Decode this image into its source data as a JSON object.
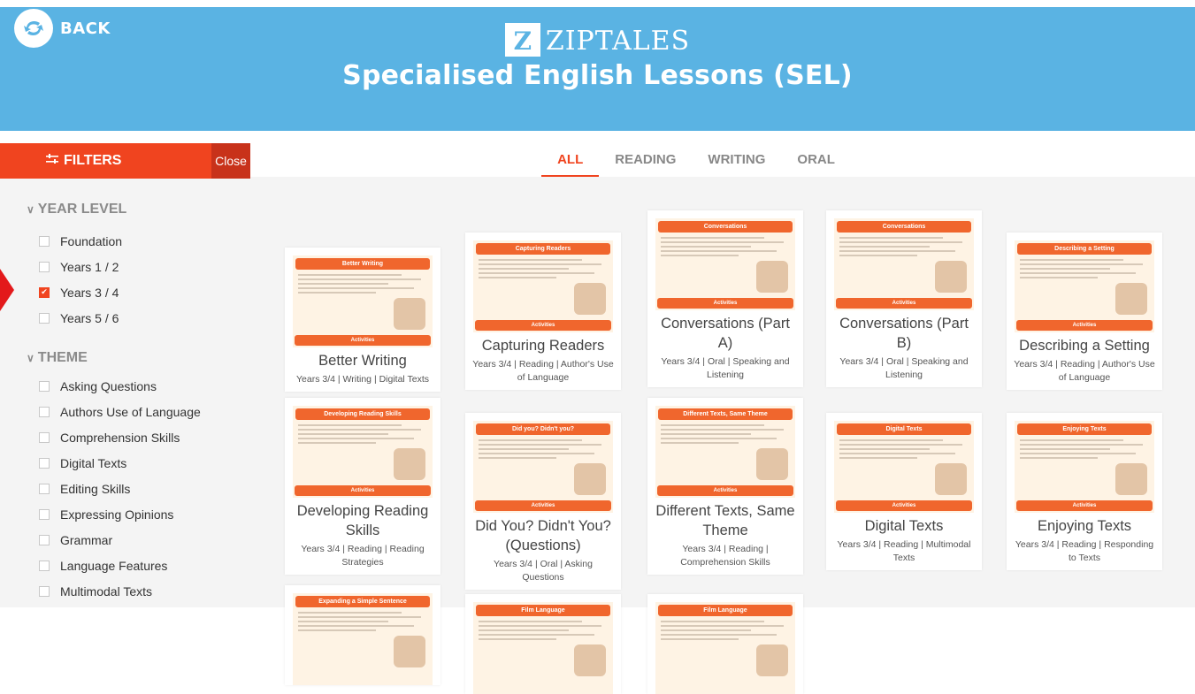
{
  "header": {
    "back_label": "BACK",
    "brand_name": "ZIPTALES",
    "brand_letter": "Z",
    "subtitle": "Specialised English Lessons (SEL)"
  },
  "filters": {
    "title": "FILTERS",
    "close_label": "Close",
    "year_level": {
      "heading": "YEAR LEVEL",
      "options": [
        {
          "label": "Foundation",
          "checked": false
        },
        {
          "label": "Years 1 / 2",
          "checked": false
        },
        {
          "label": "Years 3 / 4",
          "checked": true
        },
        {
          "label": "Years 5 / 6",
          "checked": false
        }
      ]
    },
    "theme": {
      "heading": "THEME",
      "options": [
        {
          "label": "Asking Questions",
          "checked": false
        },
        {
          "label": "Authors Use of Language",
          "checked": false
        },
        {
          "label": "Comprehension Skills",
          "checked": false
        },
        {
          "label": "Digital Texts",
          "checked": false
        },
        {
          "label": "Editing Skills",
          "checked": false
        },
        {
          "label": "Expressing Opinions",
          "checked": false
        },
        {
          "label": "Grammar",
          "checked": false
        },
        {
          "label": "Language Features",
          "checked": false
        },
        {
          "label": "Multimodal Texts",
          "checked": false
        }
      ]
    }
  },
  "tabs": [
    {
      "label": "ALL",
      "active": true
    },
    {
      "label": "READING",
      "active": false
    },
    {
      "label": "WRITING",
      "active": false
    },
    {
      "label": "ORAL",
      "active": false
    }
  ],
  "cards": [
    {
      "thumb_title": "Better Writing",
      "title": "Better Writing",
      "meta": "Years 3/4 | Writing | Digital Texts",
      "button": "Activities"
    },
    {
      "thumb_title": "Capturing Readers",
      "title": "Capturing Readers",
      "meta": "Years 3/4 | Reading | Author's Use of Language",
      "button": "Activities"
    },
    {
      "thumb_title": "Conversations",
      "title": "Conversations (Part A)",
      "meta": "Years 3/4 | Oral | Speaking and Listening",
      "button": "Activities"
    },
    {
      "thumb_title": "Conversations",
      "title": "Conversations (Part B)",
      "meta": "Years 3/4 | Oral | Speaking and Listening",
      "button": "Activities"
    },
    {
      "thumb_title": "Describing a Setting",
      "title": "Describing a Setting",
      "meta": "Years 3/4 | Reading | Author's Use of Language",
      "button": "Activities"
    },
    {
      "thumb_title": "Developing Reading Skills",
      "title": "Developing Reading Skills",
      "meta": "Years 3/4 | Reading | Reading Strategies",
      "button": "Activities"
    },
    {
      "thumb_title": "Did you? Didn't you?",
      "title": "Did You? Didn't You? (Questions)",
      "meta": "Years 3/4 | Oral | Asking Questions",
      "button": "Activities"
    },
    {
      "thumb_title": "Different Texts, Same Theme",
      "title": "Different Texts, Same Theme",
      "meta": "Years 3/4 | Reading | Comprehension Skills",
      "button": "Activities"
    },
    {
      "thumb_title": "Digital Texts",
      "title": "Digital Texts",
      "meta": "Years 3/4 | Reading | Multimodal Texts",
      "button": "Activities"
    },
    {
      "thumb_title": "Enjoying Texts",
      "title": "Enjoying Texts",
      "meta": "Years 3/4 | Reading | Responding to Texts",
      "button": "Activities"
    },
    {
      "thumb_title": "Expanding a Simple Sentence",
      "title": "",
      "meta": "",
      "button": ""
    },
    {
      "thumb_title": "Film Language",
      "title": "",
      "meta": "",
      "button": ""
    },
    {
      "thumb_title": "Film Language",
      "title": "",
      "meta": "",
      "button": ""
    }
  ],
  "colors": {
    "header_bg": "#5ab3e3",
    "accent": "#f0441f",
    "thumb_accent": "#f0662d"
  }
}
